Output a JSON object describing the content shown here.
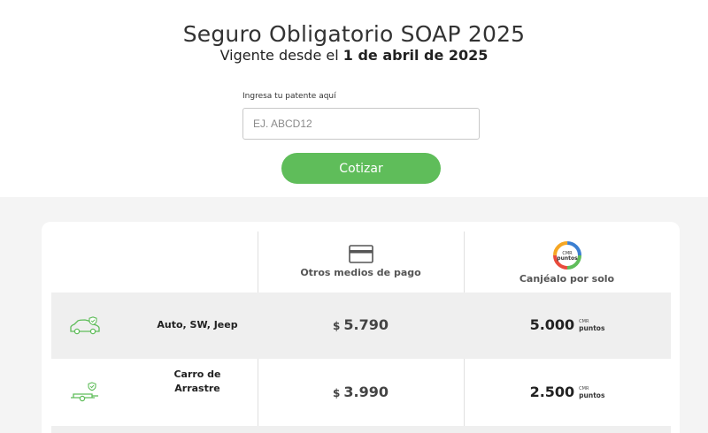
{
  "header": {
    "title": "Seguro Obligatorio SOAP 2025",
    "subtitle_prefix": "Vigente desde el",
    "subtitle_date": "1 de abril de 2025"
  },
  "form": {
    "label": "Ingresa tu patente aquí",
    "placeholder": "EJ. ABCD12",
    "value": "",
    "submit_label": "Cotizar"
  },
  "table": {
    "columns": [
      {
        "label": "Otros medios de pago",
        "icon": "credit-card-icon"
      },
      {
        "label": "Canjéalo por solo",
        "icon": "cmr-puntos-logo",
        "logo_text": [
          "CMR",
          "puntos"
        ]
      }
    ],
    "points_unit": {
      "brand": "CMR",
      "unit": "puntos"
    },
    "rows": [
      {
        "label": "Auto, SW, Jeep",
        "icon": "car-shield-icon",
        "currency": "$",
        "price": "5.790",
        "points": "5.000"
      },
      {
        "label": "Carro de Arrastre",
        "icon": "trailer-shield-icon",
        "currency": "$",
        "price": "3.990",
        "points": "2.500"
      }
    ]
  },
  "colors": {
    "accent_green": "#5fbd5a",
    "background_grey": "#f4f4f4",
    "row_shade": "#efefef",
    "text_dark": "#222222"
  }
}
